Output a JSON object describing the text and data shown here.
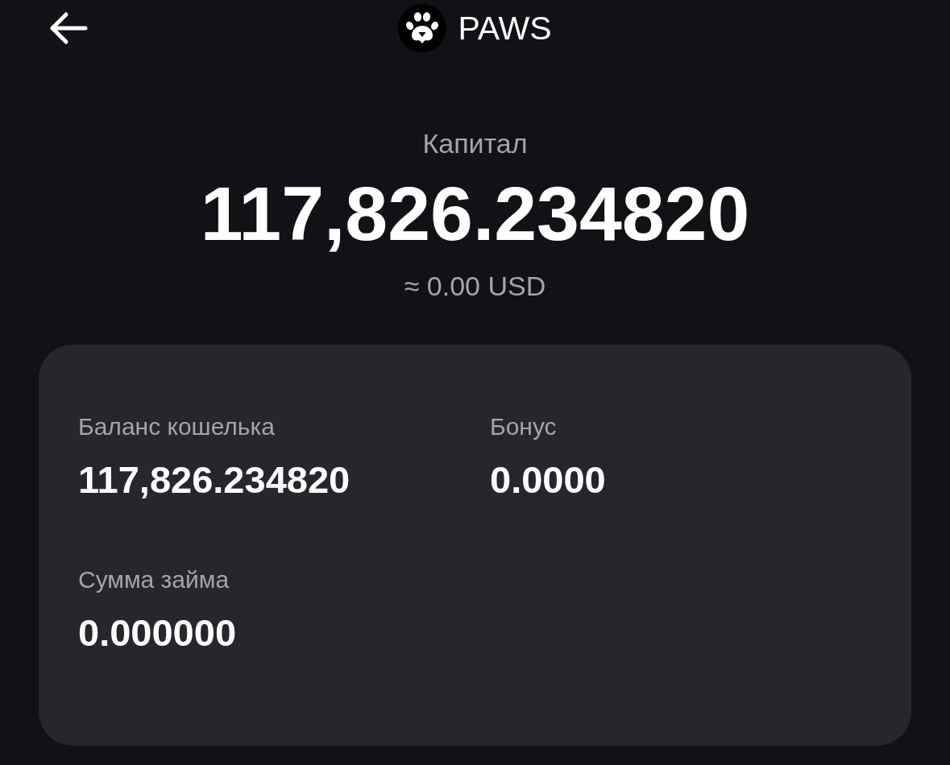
{
  "header": {
    "title": "PAWS"
  },
  "capital": {
    "label": "Капитал",
    "amount": "117,826.234820",
    "usd_estimate": "≈ 0.00 USD"
  },
  "details": [
    {
      "label": "Баланс кошелька",
      "value": "117,826.234820"
    },
    {
      "label": "Бонус",
      "value": "0.0000"
    },
    {
      "label": "Сумма займа",
      "value": "0.000000"
    }
  ]
}
